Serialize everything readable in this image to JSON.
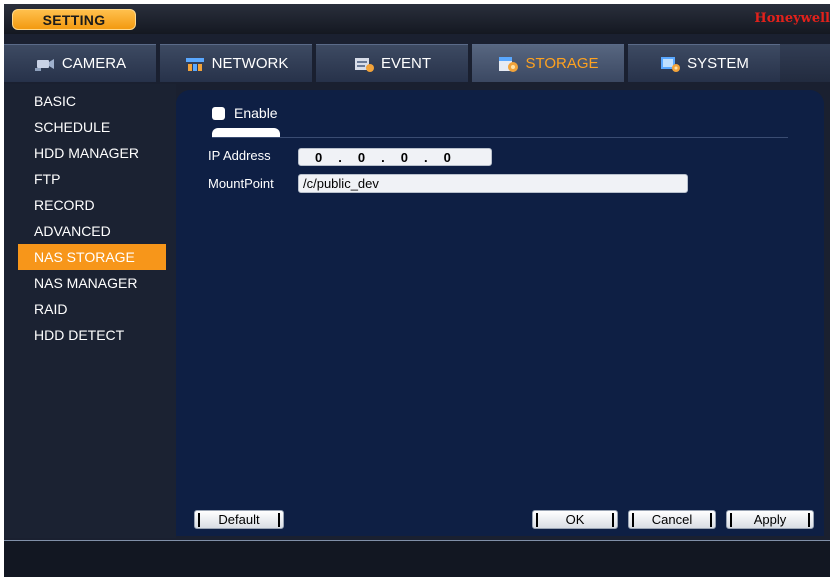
{
  "header": {
    "title": "SETTING",
    "brand": "Honeywell"
  },
  "tabs": [
    {
      "label": "CAMERA",
      "icon": "camera-icon",
      "active": false
    },
    {
      "label": "NETWORK",
      "icon": "network-icon",
      "active": false
    },
    {
      "label": "EVENT",
      "icon": "event-icon",
      "active": false
    },
    {
      "label": "STORAGE",
      "icon": "storage-icon",
      "active": true
    },
    {
      "label": "SYSTEM",
      "icon": "system-icon",
      "active": false
    }
  ],
  "sidebar": {
    "items": [
      {
        "label": "BASIC"
      },
      {
        "label": "SCHEDULE"
      },
      {
        "label": "HDD MANAGER"
      },
      {
        "label": "FTP"
      },
      {
        "label": "RECORD"
      },
      {
        "label": "ADVANCED"
      },
      {
        "label": "NAS STORAGE"
      },
      {
        "label": "NAS MANAGER"
      },
      {
        "label": "RAID"
      },
      {
        "label": "HDD DETECT"
      }
    ],
    "active_index": 6
  },
  "form": {
    "enable_label": "Enable",
    "enable_checked": false,
    "ip_label": "IP Address",
    "ip_octets": [
      "0",
      "0",
      "0",
      "0"
    ],
    "ip_separator": ".",
    "mount_label": "MountPoint",
    "mount_value": "/c/public_dev"
  },
  "buttons": {
    "default": "Default",
    "ok": "OK",
    "cancel": "Cancel",
    "apply": "Apply"
  },
  "colors": {
    "accent": "#f7961a",
    "active_tab_text": "#ffa21f",
    "brand": "#e3211b",
    "content_bg": "#0e1f44"
  }
}
